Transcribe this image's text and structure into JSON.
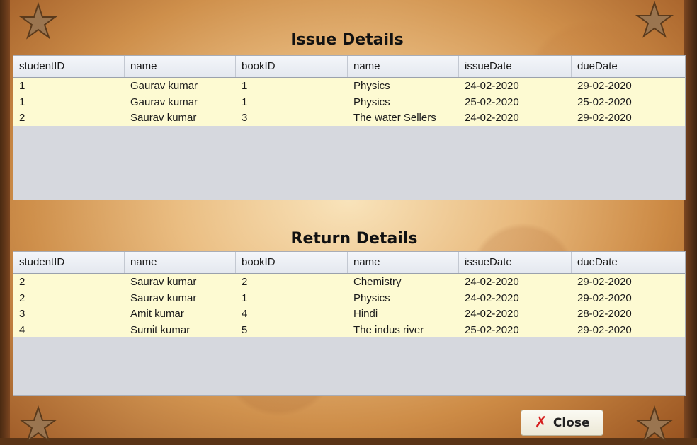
{
  "issue": {
    "title": "Issue Details",
    "columns": [
      "studentID",
      "name",
      "bookID",
      "name",
      "issueDate",
      "dueDate"
    ],
    "rows": [
      [
        "1",
        "Gaurav kumar",
        "1",
        "Physics",
        "24-02-2020",
        "29-02-2020"
      ],
      [
        "1",
        "Gaurav kumar",
        "1",
        "Physics",
        "25-02-2020",
        "25-02-2020"
      ],
      [
        "2",
        "Saurav kumar",
        "3",
        "The water Sellers",
        "24-02-2020",
        "29-02-2020"
      ]
    ]
  },
  "return": {
    "title": "Return Details",
    "columns": [
      "studentID",
      "name",
      "bookID",
      "name",
      "issueDate",
      "dueDate"
    ],
    "rows": [
      [
        "2",
        "Saurav kumar",
        "2",
        "Chemistry",
        "24-02-2020",
        "29-02-2020"
      ],
      [
        "2",
        "Saurav kumar",
        "1",
        "Physics",
        "24-02-2020",
        "29-02-2020"
      ],
      [
        "3",
        "Amit kumar",
        "4",
        "Hindi",
        "24-02-2020",
        "28-02-2020"
      ],
      [
        "4",
        "Sumit kumar",
        "5",
        "The indus river",
        "25-02-2020",
        "29-02-2020"
      ]
    ]
  },
  "close_button": {
    "label": "Close",
    "icon": "close-icon",
    "icon_color": "#d61f1f"
  },
  "colors": {
    "row_background": "#fdfad2",
    "empty_area": "#d6d8de"
  }
}
